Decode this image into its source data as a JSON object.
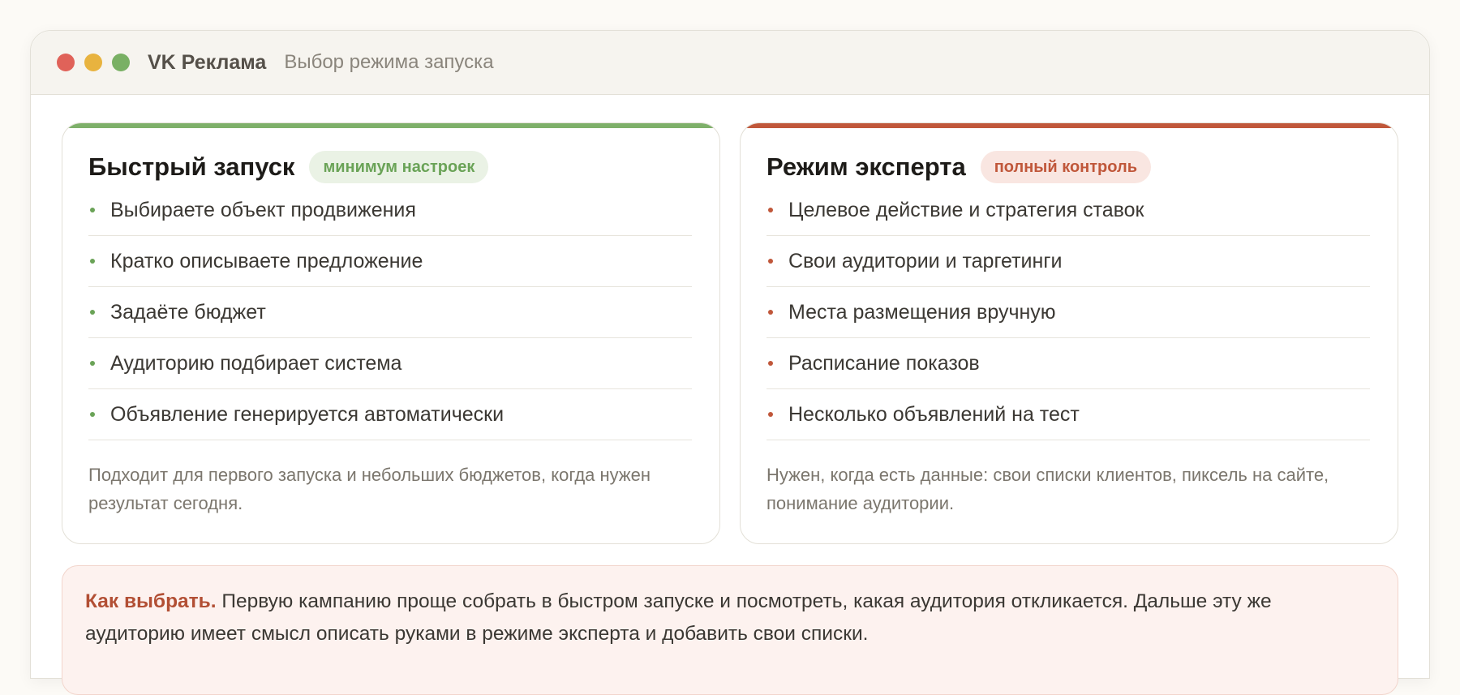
{
  "window": {
    "app_name": "VK Реклама",
    "subtitle": "Выбор режима запуска",
    "traffic_lights": [
      {
        "name": "close",
        "color": "#e06259"
      },
      {
        "name": "minimize",
        "color": "#e8b33f"
      },
      {
        "name": "zoom",
        "color": "#79b064"
      }
    ]
  },
  "quick": {
    "title": "Быстрый запуск",
    "badge": "минимум настроек",
    "accent": "#7eb06a",
    "items": [
      "Выбираете объект продвижения",
      "Кратко описываете предложение",
      "Задаёте бюджет",
      "Аудиторию подбирает система",
      "Объявление генерируется автоматически"
    ],
    "note": "Подходит для первого запуска и небольших бюджетов, когда нужен результат сегодня."
  },
  "expert": {
    "title": "Режим эксперта",
    "badge": "полный контроль",
    "accent": "#c0573a",
    "items": [
      "Целевое действие и стратегия ставок",
      "Свои аудитории и таргетинги",
      "Места размещения вручную",
      "Расписание показов",
      "Несколько объявлений на тест"
    ],
    "note": "Нужен, когда есть данные: свои списки клиентов, пиксель на сайте, понимание аудитории."
  },
  "callout": {
    "lead": "Как выбрать.",
    "text": "Первую кампанию проще собрать в быстром запуске и посмотреть, какая аудитория откликается. Дальше эту же аудиторию имеет смысл описать руками в режиме эксперта и добавить свои списки."
  }
}
